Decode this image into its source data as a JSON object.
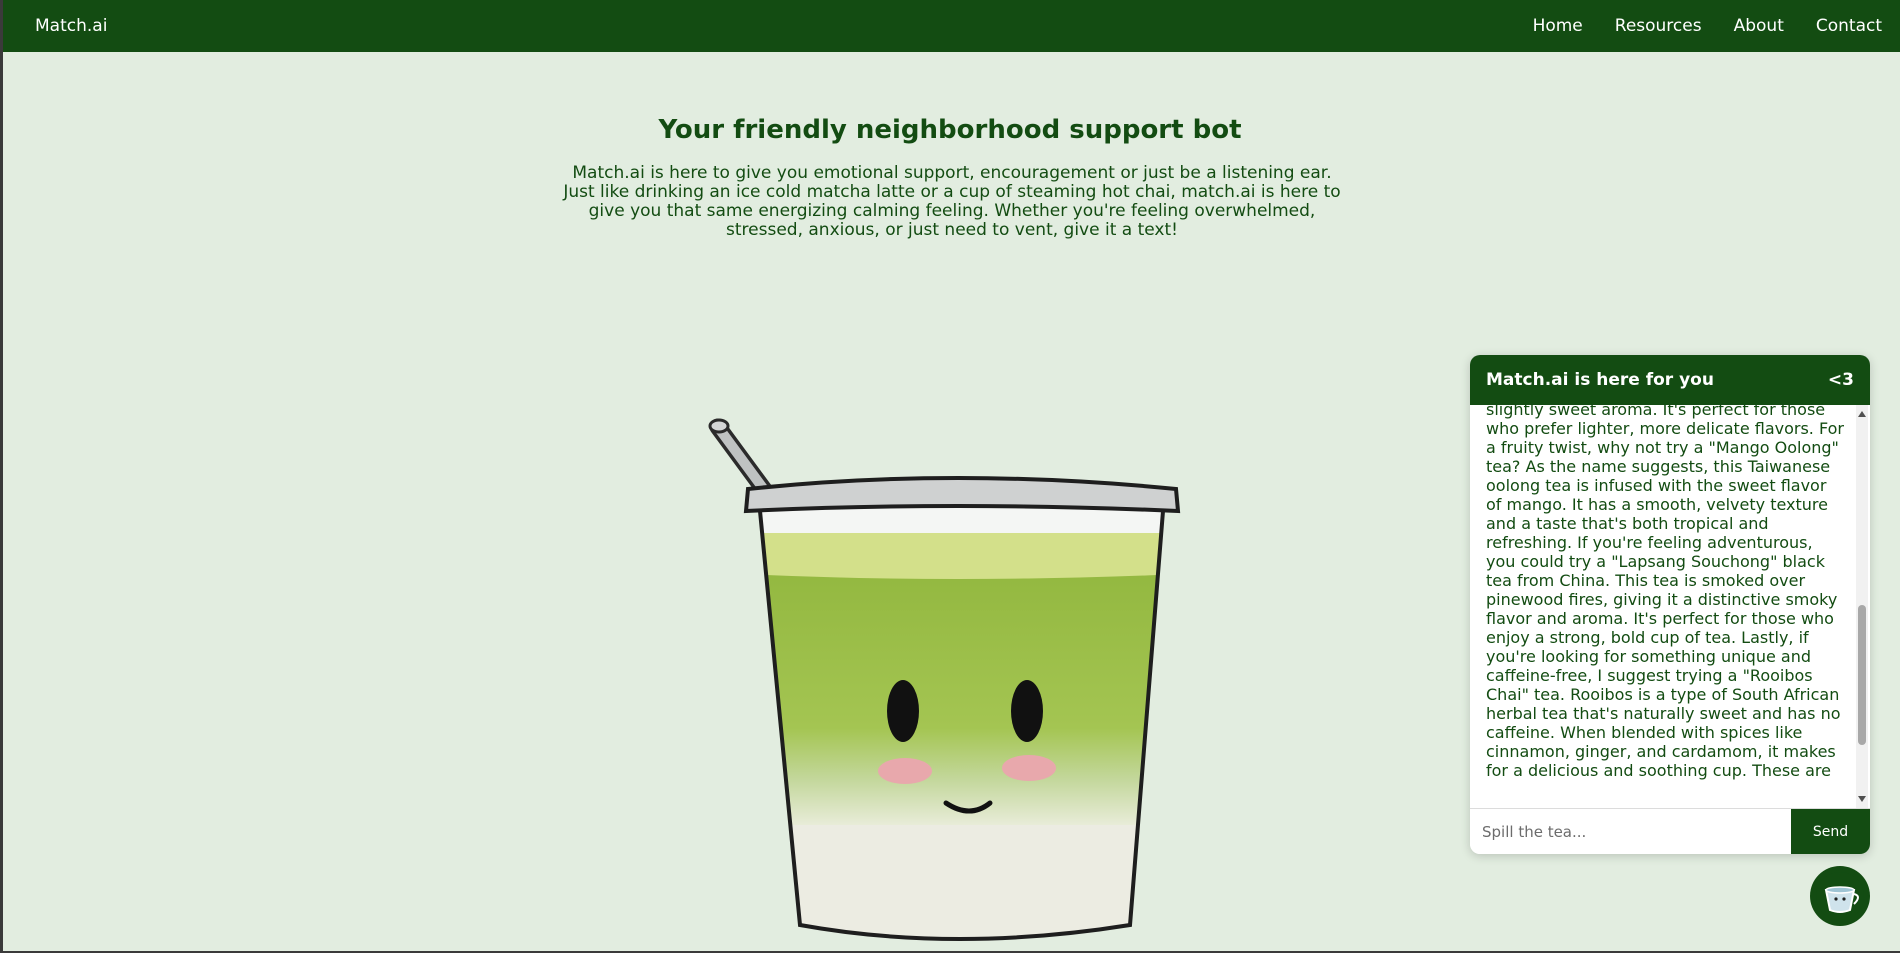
{
  "nav": {
    "brand": "Match.ai",
    "links": [
      "Home",
      "Resources",
      "About",
      "Contact"
    ]
  },
  "hero": {
    "title": "Your friendly neighborhood support bot",
    "description": "Match.ai is here to give you emotional support, encouragement or just be a listening ear. Just like drinking an ice cold matcha latte or a cup of steaming hot chai, match.ai is here to give you that same energizing calming feeling. Whether you're feeling overwhelmed, stressed, anxious, or just need to vent, give it a text!"
  },
  "chat": {
    "title": "Match.ai is here for you",
    "heart": "<3",
    "message": "jasmine flowers, giving it a floral and slightly sweet aroma. It's perfect for those who prefer lighter, more delicate flavors. For a fruity twist, why not try a \"Mango Oolong\" tea? As the name suggests, this Taiwanese oolong tea is infused with the sweet flavor of mango. It has a smooth, velvety texture and a taste that's both tropical and refreshing. If you're feeling adventurous, you could try a \"Lapsang Souchong\" black tea from China. This tea is smoked over pinewood fires, giving it a distinctive smoky flavor and aroma. It's perfect for those who enjoy a strong, bold cup of tea. Lastly, if you're looking for something unique and caffeine-free, I suggest trying a \"Rooibos Chai\" tea. Rooibos is a type of South African herbal tea that's naturally sweet and has no caffeine. When blended with spices like cinnamon, ginger, and cardamom, it makes for a delicious and soothing cup. These are",
    "input_placeholder": "Spill the tea...",
    "send_label": "Send"
  },
  "colors": {
    "brand_green": "#134c12",
    "page_background": "#e2ede0",
    "matcha": "#9cbf45",
    "foam": "#d3e08a"
  }
}
